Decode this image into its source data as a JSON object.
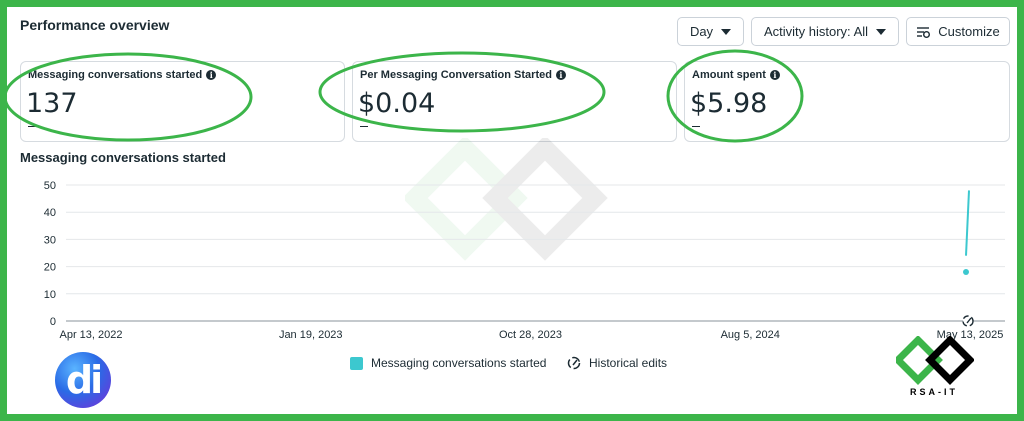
{
  "header": {
    "title": "Performance overview",
    "day_label": "Day",
    "activity_label": "Activity history: All",
    "customize_label": "Customize"
  },
  "cards": [
    {
      "label": "Messaging conversations started",
      "value": "137"
    },
    {
      "label": "Per Messaging Conversation Started",
      "value": "$0.04"
    },
    {
      "label": "Amount spent",
      "value": "$5.98"
    }
  ],
  "chart_title": "Messaging conversations started",
  "chart_data": {
    "type": "line",
    "title": "",
    "ylim": [
      0,
      50
    ],
    "yticks": [
      "50",
      "40",
      "30",
      "20",
      "10",
      "0"
    ],
    "xticks": [
      "Apr 13, 2022",
      "Jan 19, 2023",
      "Oct 28, 2023",
      "Aug 5, 2024",
      "May 13, 2025"
    ],
    "series": [
      {
        "name": "Messaging conversations started",
        "x": [
          "May 12, 2025",
          "May 13, 2025"
        ],
        "values": [
          18,
          48
        ],
        "color": "#3cc8cf"
      }
    ],
    "grid": true,
    "legend": "bottom-center"
  },
  "legend": {
    "series_label": "Messaging conversations started",
    "edits_label": "Historical edits"
  },
  "colors": {
    "accent": "#3cc8cf",
    "frame": "#3cb54a",
    "annotation": "#3cb54a"
  },
  "watermark": "RSA-IT",
  "logos": {
    "left": "di",
    "right": "RSA-IT"
  }
}
